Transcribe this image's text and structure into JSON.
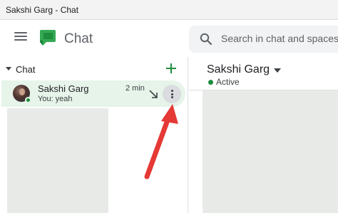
{
  "window": {
    "title": "Sakshi Garg - Chat"
  },
  "header": {
    "app_name": "Chat",
    "search": {
      "placeholder": "Search in chat and spaces"
    }
  },
  "sidebar": {
    "section_label": "Chat",
    "chats": [
      {
        "name": "Sakshi Garg",
        "time": "2 min",
        "preview": "You: yeah",
        "selected": true
      }
    ]
  },
  "conversation": {
    "name": "Sakshi Garg",
    "status": "Active"
  },
  "colors": {
    "accent_green": "#1e8e3e",
    "selected_bg": "#e6f4ea",
    "annotation_red": "#e53935"
  }
}
